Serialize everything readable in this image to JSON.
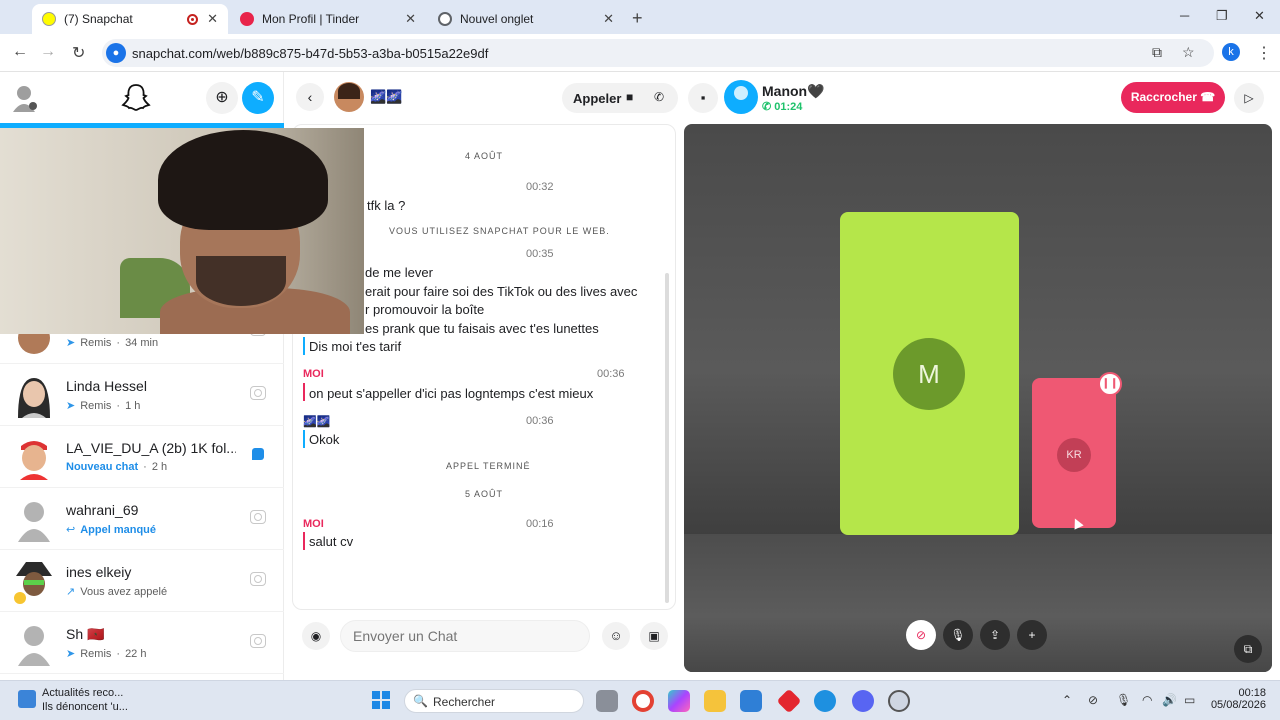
{
  "browser": {
    "tabs": [
      {
        "title": "(7) Snapchat",
        "active": true
      },
      {
        "title": "Mon Profil | Tinder",
        "active": false
      },
      {
        "title": "Nouvel onglet",
        "active": false
      }
    ],
    "url": "snapchat.com/web/b889c875-b47d-5b53-a3ba-b0515a22e9df",
    "profile_initial": "k"
  },
  "chat_header": {
    "appeler_label": "Appeler",
    "caller_name": "Manon🖤",
    "call_timer": "01:24",
    "hangup_label": "Raccrocher",
    "friend_name": "🌌🌌"
  },
  "chat_list": [
    {
      "name": "",
      "status": "Remis",
      "time": "34 min",
      "kind": "sent"
    },
    {
      "name": "Linda Hessel",
      "status": "Remis",
      "time": "1 h",
      "kind": "sent"
    },
    {
      "name": "LA_VIE_DU_A (2b) 1K fol...",
      "status": "Nouveau chat",
      "time": "2 h",
      "kind": "new"
    },
    {
      "name": "wahrani_69",
      "status": "Appel manqué",
      "time": "",
      "kind": "missed"
    },
    {
      "name": "ines elkeiy",
      "status": "Vous avez appelé",
      "time": "",
      "kind": "called"
    },
    {
      "name": "Sh 🇲🇦",
      "status": "Remis",
      "time": "22 h",
      "kind": "sent"
    }
  ],
  "messages": {
    "date1": "4 AOÛT",
    "t1": "00:32",
    "m1": "tfk la ?",
    "web_notice": "VOUS UTILISEZ SNAPCHAT POUR LE WEB.",
    "t2": "00:35",
    "m2a": "de me lever",
    "m2b": "erait pour faire soi des TikTok ou des lives avec",
    "m2c": "r promouvoir la boîte",
    "m2d": "es prank que tu faisais avec t'es lunettes",
    "m2e": "Dis moi t'es tarif",
    "sender_moi": "MOI",
    "t3": "00:36",
    "m3": "on peut s'appeller d'ici pas logntemps c'est mieux",
    "sender_friend": "🌌🌌",
    "t4": "00:36",
    "m4": "Okok",
    "call_ended": "APPEL TERMINÉ",
    "date2": "5 AOÛT",
    "sender_moi2": "MOI",
    "t5": "00:16",
    "m5": "salut cv"
  },
  "composer": {
    "placeholder": "Envoyer un Chat"
  },
  "call_stage": {
    "tile_main_initial": "M",
    "tile_small_initials": "KR"
  },
  "taskbar": {
    "news_line1": "Actualités reco...",
    "news_line2": "Ils dénoncent 'u...",
    "search_label": "Rechercher",
    "time": "00:18",
    "date": "05/08/2026"
  }
}
